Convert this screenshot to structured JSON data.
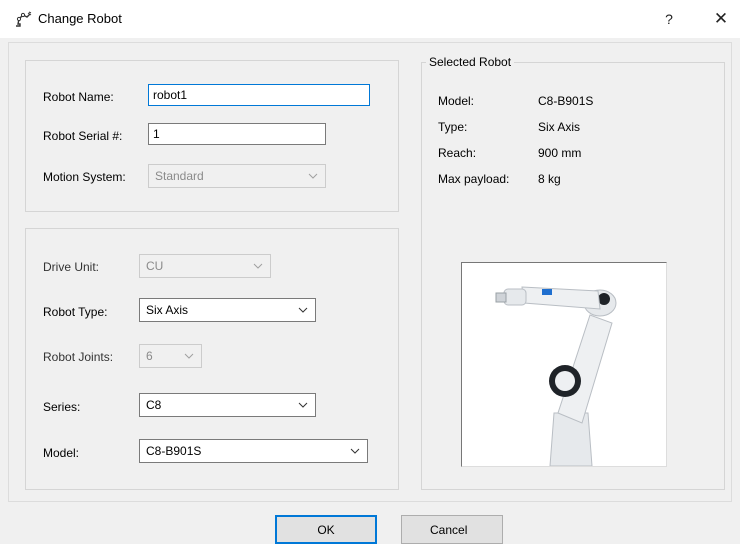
{
  "window": {
    "title": "Change Robot",
    "help_label": "?",
    "close_label": "✕"
  },
  "robot_info": {
    "robot_name_label": "Robot Name:",
    "robot_name_value": "robot1",
    "serial_label": "Robot Serial #:",
    "serial_value": "1",
    "motion_label": "Motion System:",
    "motion_value": "Standard"
  },
  "robot_config": {
    "drive_unit_label": "Drive Unit:",
    "drive_unit_value": "CU",
    "robot_type_label": "Robot Type:",
    "robot_type_value": "Six Axis",
    "robot_joints_label": "Robot Joints:",
    "robot_joints_value": "6",
    "series_label": "Series:",
    "series_value": "C8",
    "model_label": "Model:",
    "model_value": "C8-B901S"
  },
  "selected_robot": {
    "group_title": "Selected Robot",
    "model_label": "Model:",
    "model_value": "C8-B901S",
    "type_label": "Type:",
    "type_value": "Six Axis",
    "reach_label": "Reach:",
    "reach_value": "900 mm",
    "payload_label": "Max payload:",
    "payload_value": "8 kg"
  },
  "buttons": {
    "ok": "OK",
    "cancel": "Cancel"
  },
  "colors": {
    "focus_accent": "#0078d7",
    "robot_body": "#e6e9ec",
    "robot_joint": "#1f2328",
    "robot_accent": "#1f6fcf"
  },
  "icons": {
    "title": "robot-arm-icon",
    "dropdown": "chevron-down-icon"
  }
}
